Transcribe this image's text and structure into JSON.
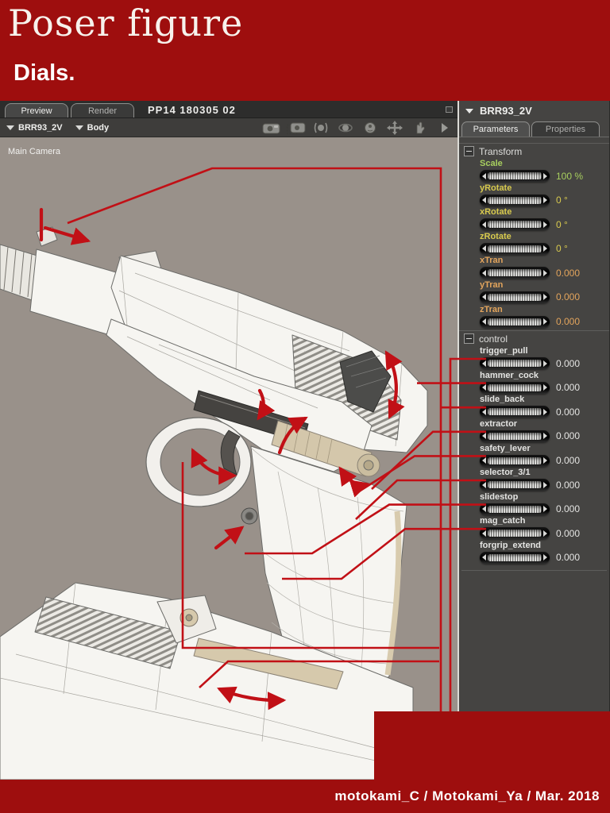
{
  "header": {
    "title": "Poser figure",
    "subtitle": "Dials."
  },
  "workspace": {
    "tabs": [
      {
        "label": "Preview",
        "active": true
      },
      {
        "label": "Render",
        "active": false
      }
    ],
    "document_title": "PP14 180305 02",
    "figure_selector": "BRR93_2V",
    "actor_selector": "Body",
    "camera_label": "Main Camera",
    "toolbar_icons": [
      "camera-flyaround-icon",
      "camera-select-icon",
      "trackball-icon",
      "rotate-view-icon",
      "face-camera-icon",
      "move-view-icon",
      "hand-tool-icon",
      "scroll-arrow-icon"
    ]
  },
  "panel": {
    "title": "BRR93_2V",
    "tabs": [
      {
        "label": "Parameters",
        "active": true
      },
      {
        "label": "Properties",
        "active": false
      }
    ],
    "groups": [
      {
        "name": "Transform",
        "dials": [
          {
            "label": "Scale",
            "value": "100 %",
            "color": "green"
          },
          {
            "label": "yRotate",
            "value": "0 °",
            "color": "yellow"
          },
          {
            "label": "xRotate",
            "value": "0 °",
            "color": "yellow"
          },
          {
            "label": "zRotate",
            "value": "0 °",
            "color": "yellow"
          },
          {
            "label": "xTran",
            "value": "0.000",
            "color": "orange"
          },
          {
            "label": "yTran",
            "value": "0.000",
            "color": "orange"
          },
          {
            "label": "zTran",
            "value": "0.000",
            "color": "orange"
          }
        ]
      },
      {
        "name": "control",
        "dials": [
          {
            "label": "trigger_pull",
            "value": "0.000",
            "color": "white"
          },
          {
            "label": "hammer_cock",
            "value": "0.000",
            "color": "white"
          },
          {
            "label": "slide_back",
            "value": "0.000",
            "color": "white"
          },
          {
            "label": "extractor",
            "value": "0.000",
            "color": "white"
          },
          {
            "label": "safety_lever",
            "value": "0.000",
            "color": "white"
          },
          {
            "label": "selector_3/1",
            "value": "0.000",
            "color": "white"
          },
          {
            "label": "slidestop",
            "value": "0.000",
            "color": "white"
          },
          {
            "label": "mag_catch",
            "value": "0.000",
            "color": "white"
          },
          {
            "label": "forgrip_extend",
            "value": "0.000",
            "color": "white"
          }
        ]
      }
    ]
  },
  "footer": {
    "credit": "motokami_C / Motokami_Ya / Mar. 2018"
  },
  "colors": {
    "banner_red": "#9e0e0e",
    "annotation_red": "#c11016",
    "panel_bg": "#454442",
    "viewport_bg": "#99918a",
    "dial_green": "#a8cf5f",
    "dial_yellow": "#d8ca4e",
    "dial_orange": "#e2a45c",
    "dial_white": "#e4e4e2"
  }
}
